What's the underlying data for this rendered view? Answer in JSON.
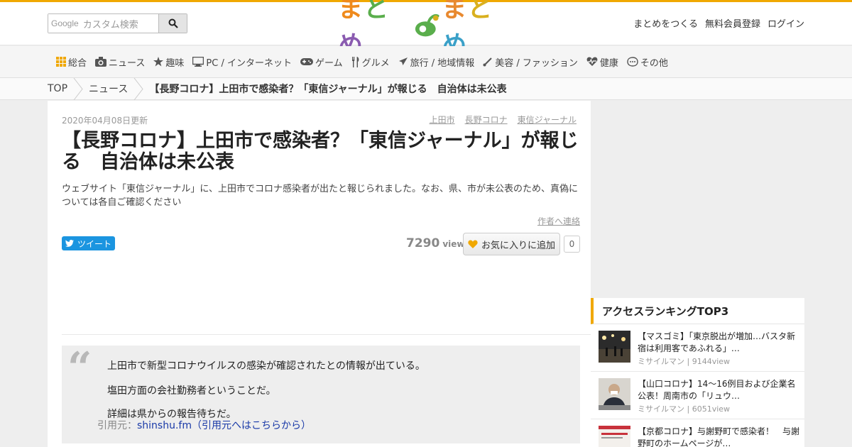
{
  "header": {
    "search_brand": "Google",
    "search_placeholder": "カスタム検索",
    "logo_left": "まとめ",
    "logo_right": "まとめ",
    "links": [
      "まとめをつくる",
      "無料会員登録",
      "ログイン"
    ]
  },
  "nav": [
    {
      "label": "総合",
      "icon": "grid-icon"
    },
    {
      "label": "ニュース",
      "icon": "camera-icon"
    },
    {
      "label": "趣味",
      "icon": "star-icon"
    },
    {
      "label": "PC / インターネット",
      "icon": "monitor-icon"
    },
    {
      "label": "ゲーム",
      "icon": "gamepad-icon"
    },
    {
      "label": "グルメ",
      "icon": "cutlery-icon"
    },
    {
      "label": "旅行 / 地域情報",
      "icon": "plane-icon"
    },
    {
      "label": "美容 / ファッション",
      "icon": "brush-icon"
    },
    {
      "label": "健康",
      "icon": "heartbeat-icon"
    },
    {
      "label": "その他",
      "icon": "other-icon"
    }
  ],
  "breadcrumb": {
    "items": [
      "TOP",
      "ニュース"
    ],
    "current": "【長野コロナ】上田市で感染者？「東信ジャーナル」が報じる　自治体は未公表"
  },
  "article": {
    "date": "2020年04月08日更新",
    "tags": [
      "上田市",
      "長野コロナ",
      "東信ジャーナル"
    ],
    "title": "【長野コロナ】上田市で感染者？「東信ジャーナル」が報じる　自治体は未公表",
    "description": "ウェブサイト「東信ジャーナル」に、上田市でコロナ感染者が出たと報じられました。なお、県、市が未公表のため、真偽については各自ご確認ください",
    "contact": "作者へ連絡",
    "tweet": "ツイート",
    "views": "7290",
    "views_unit": "view",
    "fav_label": "お気に入りに追加",
    "fav_count": "0",
    "quote_lines": [
      "上田市で新型コロナウイルスの感染が確認されたとの情報が出ている。",
      "塩田方面の会社勤務者ということだ。",
      "詳細は県からの報告待ちだ。"
    ],
    "source_prefix": "引用元：",
    "source_link": "shinshu.fm（引用元へはこちらから）"
  },
  "ranking": {
    "heading": "アクセスランキングTOP3",
    "items": [
      {
        "title": "【マスゴミ】「東京脱出が増加…バスタ新宿は利用客であふれる」…",
        "meta": "ミサイルマン | 9144view"
      },
      {
        "title": "【山口コロナ】14～16例目および企業名公表！周南市の「リュウ…",
        "meta": "ミサイルマン | 6051view"
      },
      {
        "title": "【京都コロナ】与謝野町で感染者！　与謝野町のホームページが…",
        "meta": ""
      }
    ]
  },
  "colors": {
    "accent": "#f0a800",
    "tweet": "#1b95e0",
    "link": "#1a3aa8"
  }
}
